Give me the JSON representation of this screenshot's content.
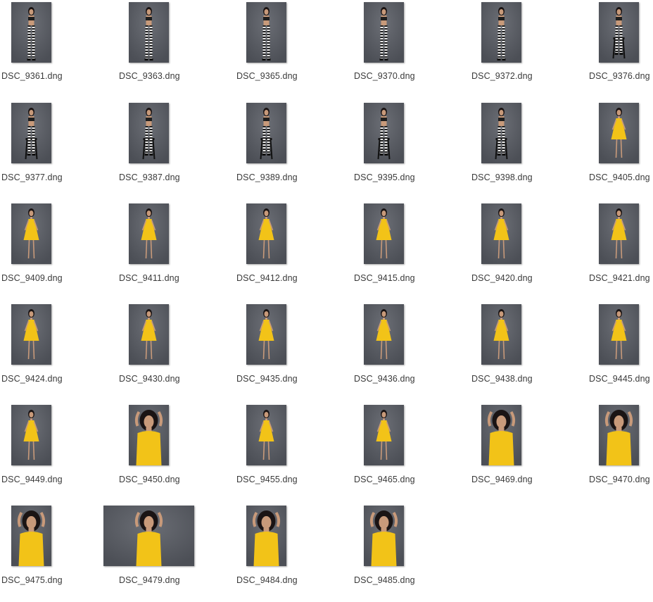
{
  "files": [
    {
      "name": "DSC_9361.dng",
      "outfit": "bw",
      "pose": "stand"
    },
    {
      "name": "DSC_9363.dng",
      "outfit": "bw",
      "pose": "stand"
    },
    {
      "name": "DSC_9365.dng",
      "outfit": "bw",
      "pose": "stand"
    },
    {
      "name": "DSC_9370.dng",
      "outfit": "bw",
      "pose": "stand"
    },
    {
      "name": "DSC_9372.dng",
      "outfit": "bw",
      "pose": "stand"
    },
    {
      "name": "DSC_9376.dng",
      "outfit": "bw",
      "pose": "stool-side"
    },
    {
      "name": "DSC_9377.dng",
      "outfit": "bw",
      "pose": "stool-side"
    },
    {
      "name": "DSC_9387.dng",
      "outfit": "bw",
      "pose": "stool-back"
    },
    {
      "name": "DSC_9389.dng",
      "outfit": "bw",
      "pose": "stool-back"
    },
    {
      "name": "DSC_9395.dng",
      "outfit": "bw",
      "pose": "stool-sit"
    },
    {
      "name": "DSC_9398.dng",
      "outfit": "bw",
      "pose": "stool-sit"
    },
    {
      "name": "DSC_9405.dng",
      "outfit": "yellow",
      "pose": "stand"
    },
    {
      "name": "DSC_9409.dng",
      "outfit": "yellow",
      "pose": "stand"
    },
    {
      "name": "DSC_9411.dng",
      "outfit": "yellow",
      "pose": "stand"
    },
    {
      "name": "DSC_9412.dng",
      "outfit": "yellow",
      "pose": "stand"
    },
    {
      "name": "DSC_9415.dng",
      "outfit": "yellow",
      "pose": "stand"
    },
    {
      "name": "DSC_9420.dng",
      "outfit": "yellow",
      "pose": "stand"
    },
    {
      "name": "DSC_9421.dng",
      "outfit": "yellow",
      "pose": "stand"
    },
    {
      "name": "DSC_9424.dng",
      "outfit": "yellow",
      "pose": "stand"
    },
    {
      "name": "DSC_9430.dng",
      "outfit": "yellow",
      "pose": "stand"
    },
    {
      "name": "DSC_9435.dng",
      "outfit": "yellow",
      "pose": "stand"
    },
    {
      "name": "DSC_9436.dng",
      "outfit": "yellow",
      "pose": "stand"
    },
    {
      "name": "DSC_9438.dng",
      "outfit": "yellow",
      "pose": "stand"
    },
    {
      "name": "DSC_9445.dng",
      "outfit": "yellow",
      "pose": "stand"
    },
    {
      "name": "DSC_9449.dng",
      "outfit": "yellow",
      "pose": "stand"
    },
    {
      "name": "DSC_9450.dng",
      "outfit": "yellow",
      "pose": "close"
    },
    {
      "name": "DSC_9455.dng",
      "outfit": "yellow",
      "pose": "stand"
    },
    {
      "name": "DSC_9465.dng",
      "outfit": "yellow",
      "pose": "stand"
    },
    {
      "name": "DSC_9469.dng",
      "outfit": "yellow",
      "pose": "close"
    },
    {
      "name": "DSC_9470.dng",
      "outfit": "yellow",
      "pose": "close"
    },
    {
      "name": "DSC_9475.dng",
      "outfit": "yellow",
      "pose": "close"
    },
    {
      "name": "DSC_9479.dng",
      "outfit": "yellow",
      "pose": "close",
      "orientation": "landscape"
    },
    {
      "name": "DSC_9484.dng",
      "outfit": "yellow",
      "pose": "close"
    },
    {
      "name": "DSC_9485.dng",
      "outfit": "yellow",
      "pose": "close"
    }
  ],
  "colors": {
    "backdrop": "#4c4f56",
    "backdrop_light": "#6b6e75",
    "dress": "#f2c318",
    "skin": "#c89a7a",
    "hair": "#1a1414",
    "stripe_dark": "#1e1e1e",
    "stripe_light": "#e8e8e8",
    "filename_text": "#3a3a3a"
  }
}
